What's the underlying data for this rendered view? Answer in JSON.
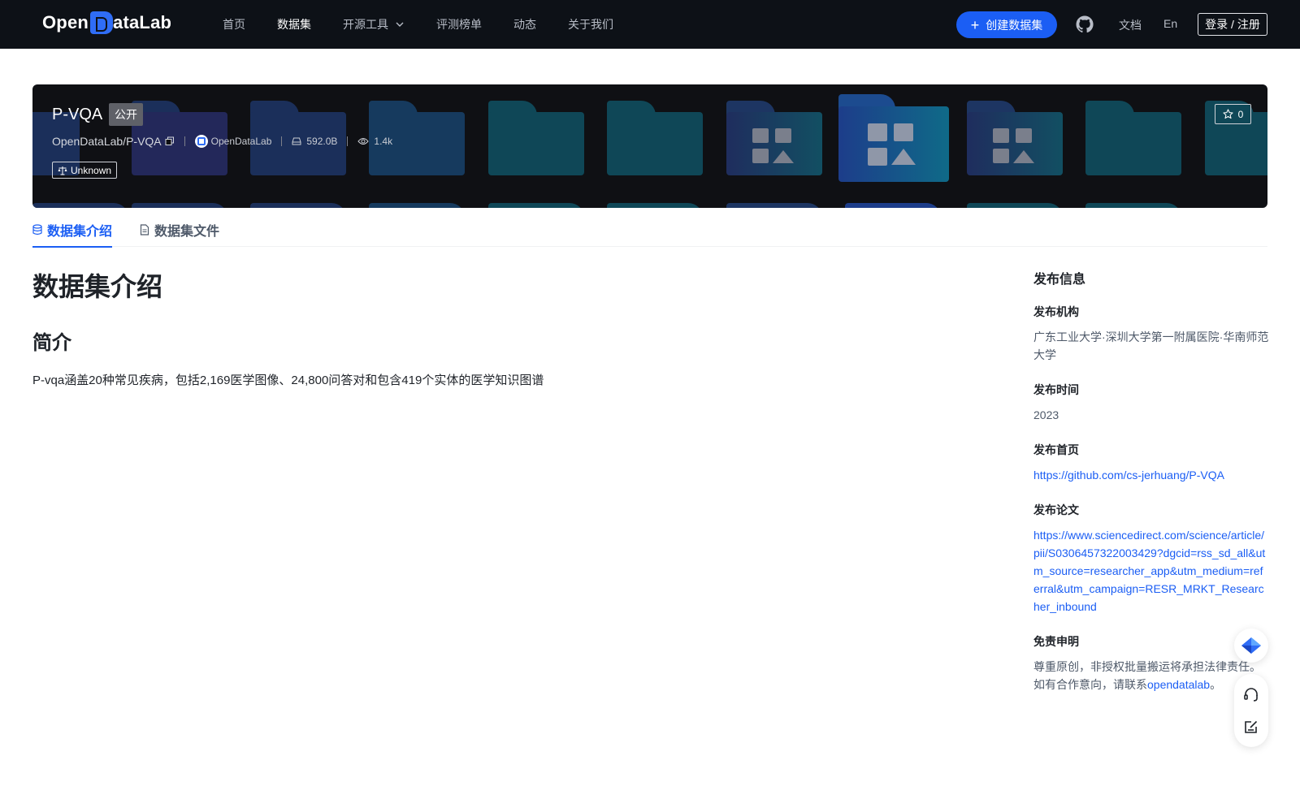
{
  "nav": {
    "logo_text_left": "Open",
    "logo_text_right": "ataLab",
    "items": [
      {
        "label": "首页",
        "active": false
      },
      {
        "label": "数据集",
        "active": true
      },
      {
        "label": "开源工具",
        "active": false,
        "has_dropdown": true
      },
      {
        "label": "评测榜单",
        "active": false
      },
      {
        "label": "动态",
        "active": false
      },
      {
        "label": "关于我们",
        "active": false
      }
    ],
    "create_label": "创建数据集",
    "docs_label": "文档",
    "lang_label": "En",
    "login_label": "登录 / 注册"
  },
  "dataset": {
    "name": "P-VQA",
    "visibility": "公开",
    "path": "OpenDataLab/P-VQA",
    "org": "OpenDataLab",
    "size": "592.0B",
    "views": "1.4k",
    "license": "Unknown",
    "stars": "0"
  },
  "tabs": [
    {
      "label": "数据集介绍",
      "active": true,
      "icon": "database-icon"
    },
    {
      "label": "数据集文件",
      "active": false,
      "icon": "file-icon"
    }
  ],
  "main": {
    "title": "数据集介绍",
    "section": "简介",
    "description": "P-vqa涵盖20种常见疾病，包括2,169医学图像、24,800问答对和包含419个实体的医学知识图谱"
  },
  "side": {
    "title": "发布信息",
    "org_label": "发布机构",
    "org_value": "广东工业大学·深圳大学第一附属医院·华南师范大学",
    "time_label": "发布时间",
    "time_value": "2023",
    "home_label": "发布首页",
    "home_value": "https://github.com/cs-jerhuang/P-VQA",
    "paper_label": "发布论文",
    "paper_value": "https://www.sciencedirect.com/science/article/pii/S0306457322003429?dgcid=rss_sd_all&utm_source=researcher_app&utm_medium=referral&utm_campaign=RESR_MRKT_Researcher_inbound",
    "disclaimer_label": "免责申明",
    "disclaimer_text": "尊重原创，非授权批量搬运将承担法律责任。如有合作意向，请联系",
    "disclaimer_link": "opendatalab",
    "disclaimer_end": "。"
  },
  "colors": {
    "accent": "#1b5ef4",
    "nav_bg": "#0d1117",
    "banner_bg": "#0f1014"
  }
}
